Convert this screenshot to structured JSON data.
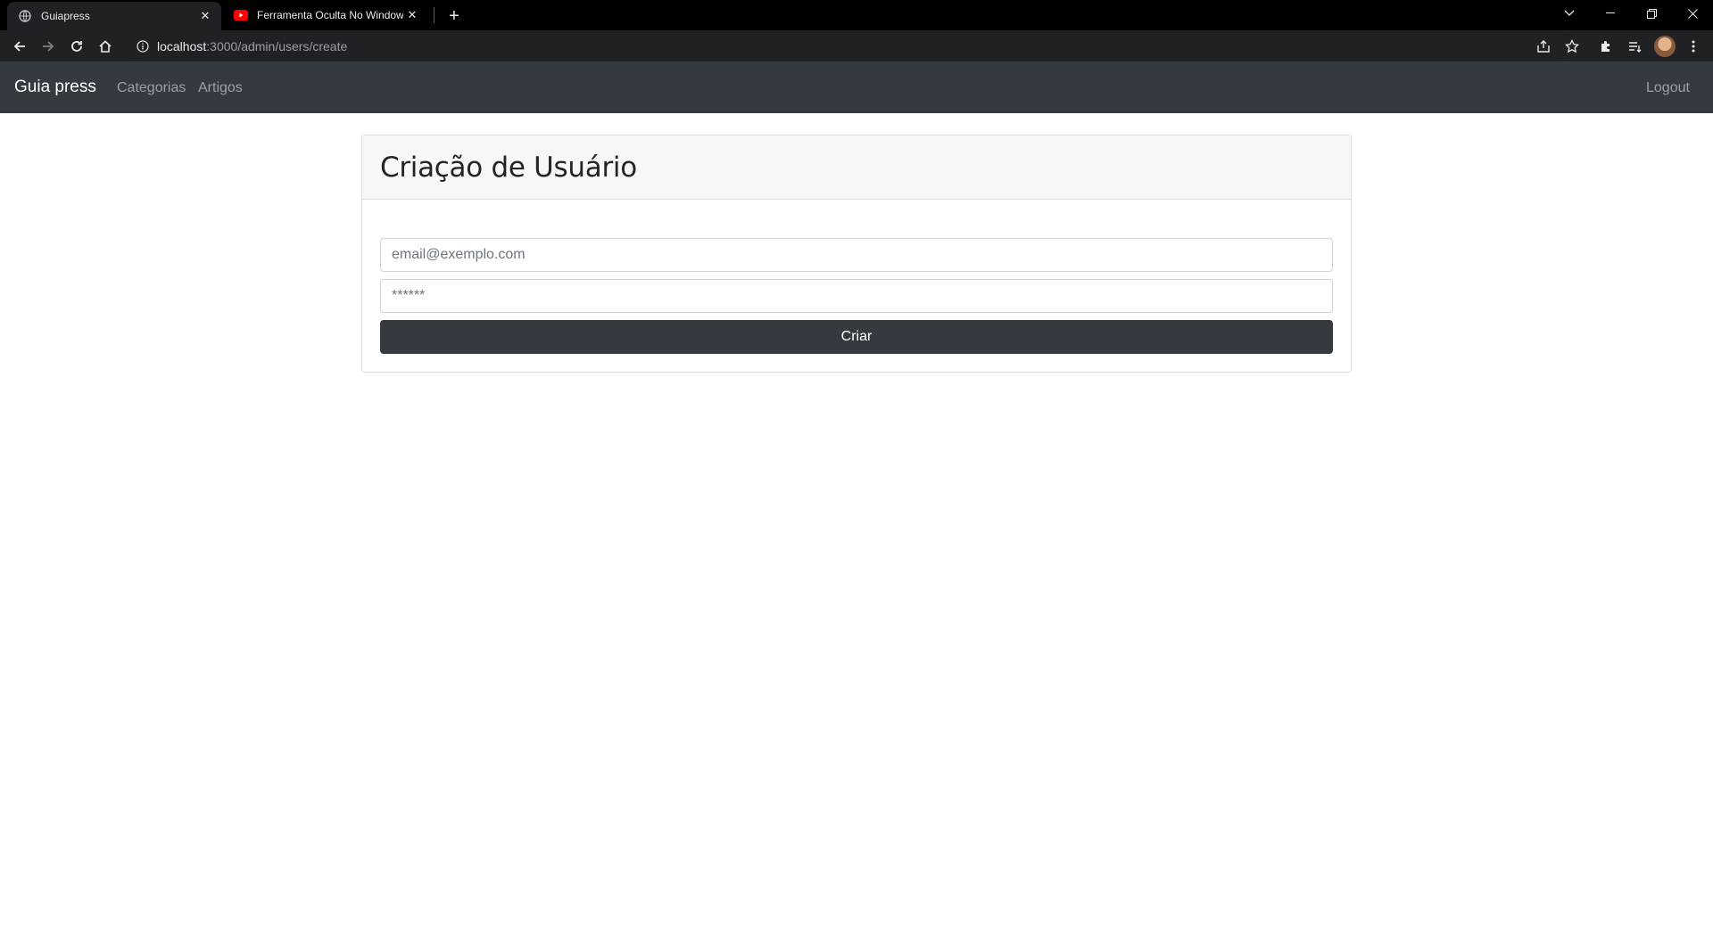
{
  "browser": {
    "tabs": [
      {
        "title": "Guiapress",
        "active": true
      },
      {
        "title": "Ferramenta Oculta No Windows",
        "active": false
      }
    ],
    "url_host": "localhost",
    "url_path": ":3000/admin/users/create"
  },
  "navbar": {
    "brand": "Guia press",
    "links": [
      "Categorias",
      "Artigos"
    ],
    "logout": "Logout"
  },
  "card": {
    "title": "Criação de Usuário",
    "email_placeholder": "email@exemplo.com",
    "password_placeholder": "******",
    "submit_label": "Criar"
  },
  "colors": {
    "navbar_bg": "#343a40",
    "button_bg": "#343a40",
    "youtube_red": "#ff0000"
  }
}
